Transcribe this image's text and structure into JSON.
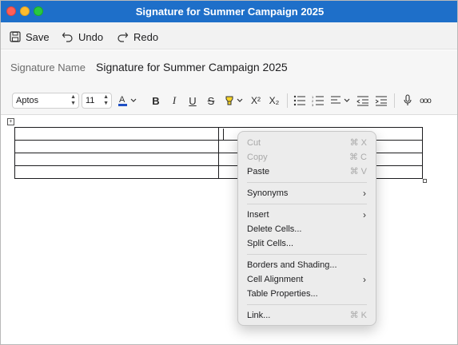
{
  "window": {
    "title": "Signature for Summer Campaign 2025"
  },
  "actions": {
    "save": "Save",
    "undo": "Undo",
    "redo": "Redo"
  },
  "signature": {
    "label": "Signature Name",
    "value": "Signature for Summer Campaign 2025"
  },
  "format": {
    "font": "Aptos",
    "size": "11",
    "bold": "B",
    "italic": "I",
    "underline": "U",
    "strike": "S",
    "superscript": "X²",
    "subscript": "X₂",
    "more": "ooo"
  },
  "menu": {
    "cut": "Cut",
    "cut_sc": "⌘ X",
    "copy": "Copy",
    "copy_sc": "⌘ C",
    "paste": "Paste",
    "paste_sc": "⌘ V",
    "synonyms": "Synonyms",
    "insert": "Insert",
    "delete_cells": "Delete Cells...",
    "split_cells": "Split Cells...",
    "borders": "Borders and Shading...",
    "cell_alignment": "Cell Alignment",
    "table_properties": "Table Properties...",
    "link": "Link...",
    "link_sc": "⌘ K"
  },
  "colors": {
    "titlebar": "#1e6fc9",
    "highlight": "#f5d328",
    "font_color": "#1f4fc4"
  }
}
